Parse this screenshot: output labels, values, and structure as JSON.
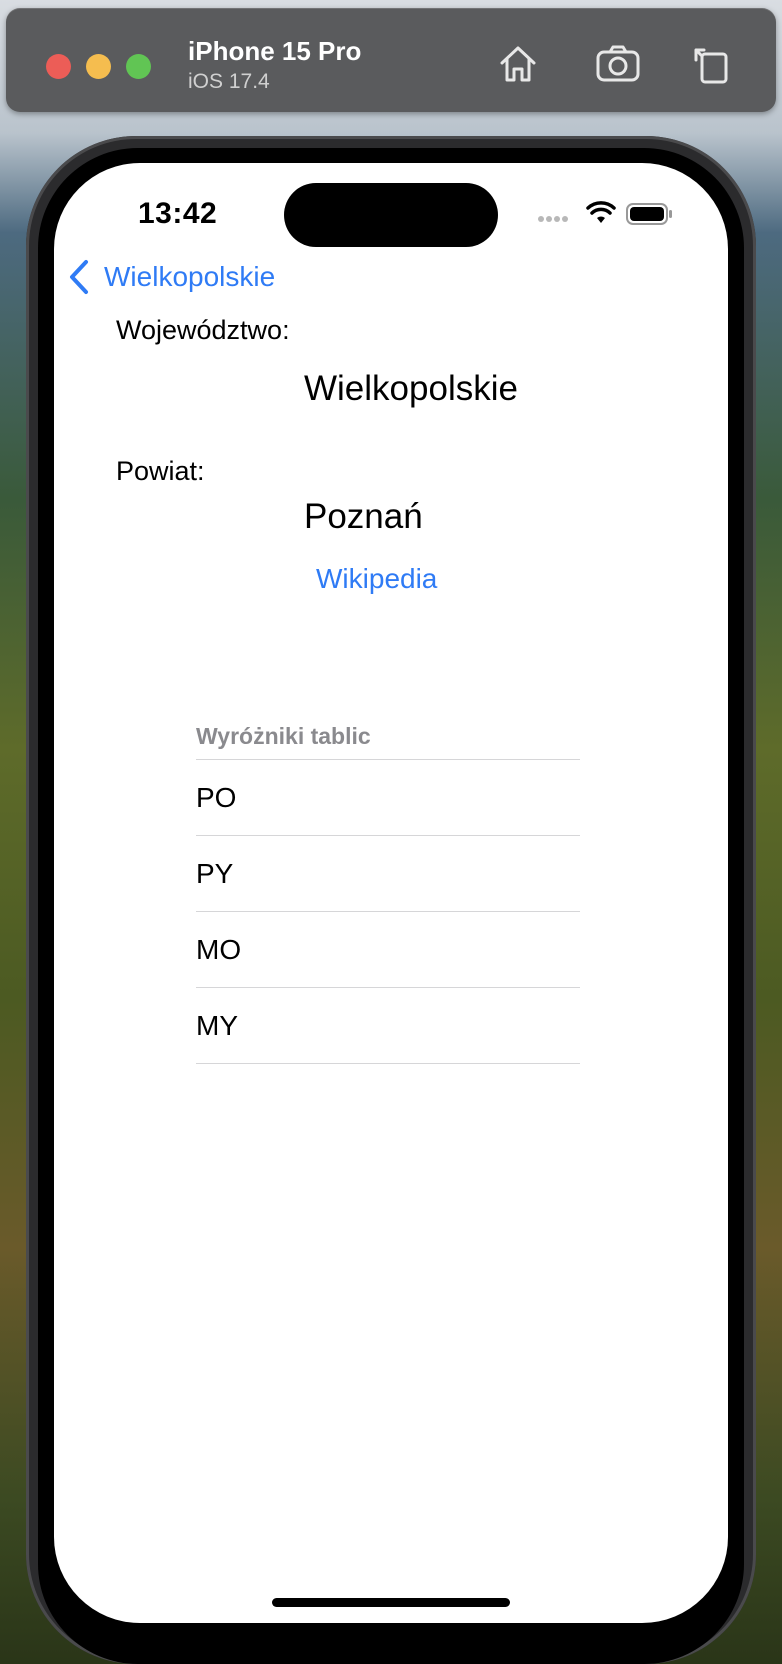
{
  "simulator": {
    "device_name": "iPhone 15 Pro",
    "os_version": "iOS 17.4",
    "buttons": [
      "home-icon",
      "screenshot-icon",
      "rotate-icon"
    ]
  },
  "status_bar": {
    "time": "13:42"
  },
  "nav": {
    "back_label": "Wielkopolskie"
  },
  "detail": {
    "voivodeship_label": "Województwo:",
    "voivodeship_value": "Wielkopolskie",
    "county_label": "Powiat:",
    "county_value": "Poznań",
    "link_label": "Wikipedia"
  },
  "plates": {
    "header": "Wyróżniki tablic",
    "items": [
      "PO",
      "PY",
      "MO",
      "MY"
    ]
  },
  "colors": {
    "accent": "#2f7bf5",
    "secondary_text": "#8a8a8e"
  }
}
